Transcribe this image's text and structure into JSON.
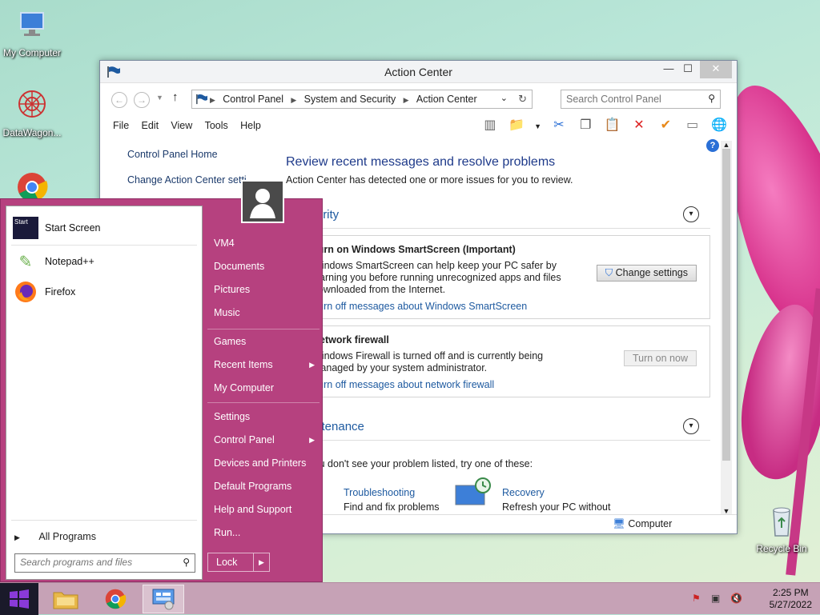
{
  "desktop": {
    "icons": [
      {
        "label": "My Computer"
      },
      {
        "label": "DataWagon..."
      },
      {
        "label": "Recycle Bin"
      }
    ]
  },
  "window": {
    "title": "Action Center",
    "controls": {
      "minimize": "—",
      "maximize": "☐",
      "close": "✕"
    },
    "breadcrumbs": [
      "Control Panel",
      "System and Security",
      "Action Center"
    ],
    "search_placeholder": "Search Control Panel",
    "menu": [
      "File",
      "Edit",
      "View",
      "Tools",
      "Help"
    ],
    "left_links": [
      "Control Panel Home",
      "Change Action Center setti"
    ],
    "heading": "Review recent messages and resolve problems",
    "subheading": "Action Center has detected one or more issues for you to review.",
    "security": {
      "title": "Security",
      "smartscreen": {
        "title": "Turn on Windows SmartScreen  (Important)",
        "body": "Windows SmartScreen can help keep your PC safer by warning you before running unrecognized apps and files downloaded from the Internet.",
        "link": "Turn off messages about Windows SmartScreen",
        "button": "Change settings"
      },
      "firewall": {
        "title": "Network firewall",
        "body": "Windows Firewall is turned off and is currently being managed by your system administrator.",
        "link": "Turn off messages about network firewall",
        "button": "Turn on now"
      }
    },
    "maintenance": {
      "title": "Maintenance",
      "text": "If you don't see your problem listed, try one of these:",
      "tools": [
        {
          "link": "Troubleshooting",
          "desc": "Find and fix problems"
        },
        {
          "link": "Recovery",
          "desc": "Refresh your PC without"
        }
      ]
    },
    "status": "Computer"
  },
  "start_menu": {
    "programs": [
      "Start Screen",
      "Notepad++",
      "Firefox"
    ],
    "all_programs": "All Programs",
    "search_placeholder": "Search programs and files",
    "right_items": [
      "VM4",
      "Documents",
      "Pictures",
      "Music",
      "Games",
      "Recent Items",
      "My Computer",
      "Settings",
      "Control Panel",
      "Devices and Printers",
      "Default Programs",
      "Help and Support",
      "Run..."
    ],
    "lock": "Lock"
  },
  "taskbar": {
    "time": "2:25 PM",
    "date": "5/27/2022"
  }
}
